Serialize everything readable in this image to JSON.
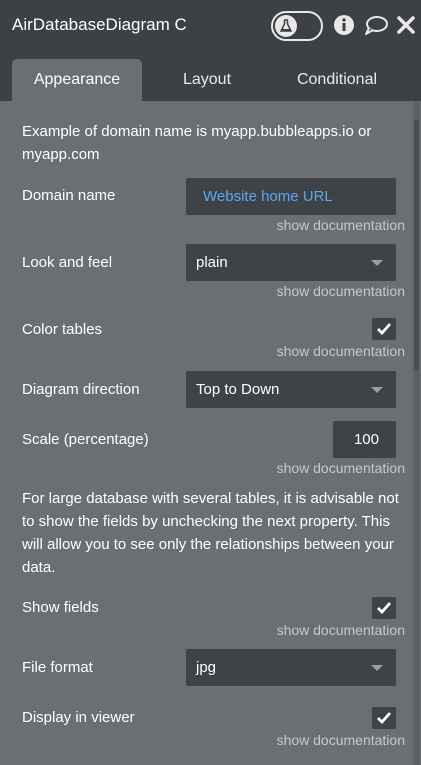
{
  "header": {
    "title": "AirDatabaseDiagram C",
    "icons": [
      "flask-icon",
      "info-icon",
      "comment-icon",
      "close-icon"
    ]
  },
  "tabs": [
    {
      "label": "Appearance",
      "active": true
    },
    {
      "label": "Layout",
      "active": false
    },
    {
      "label": "Conditional",
      "active": false
    }
  ],
  "form": {
    "intro_note": "Example of domain name is myapp.bubbleapps.io or myapp.com",
    "domain_name": {
      "label": "Domain name",
      "value": "Website home URL",
      "doc": "show documentation"
    },
    "look_and_feel": {
      "label": "Look and feel",
      "value": "plain",
      "doc": "show documentation"
    },
    "color_tables": {
      "label": "Color tables",
      "checked": true,
      "doc": "show documentation"
    },
    "diagram_direction": {
      "label": "Diagram direction",
      "value": "Top to Down"
    },
    "scale": {
      "label": "Scale (percentage)",
      "value": "100",
      "doc": "show documentation"
    },
    "fields_note": "For large database with several tables, it is advisable not to show the fields by unchecking the next property. This will allow you to see only the relationships between your data.",
    "show_fields": {
      "label": "Show fields",
      "checked": true,
      "doc": "show documentation"
    },
    "file_format": {
      "label": "File format",
      "value": "jpg"
    },
    "display_in_viewer": {
      "label": "Display in viewer",
      "checked": true,
      "doc": "show documentation"
    }
  },
  "colors": {
    "header_bg": "#3d4145",
    "panel_bg": "#6c6f72",
    "field_bg": "#3f4246",
    "link": "#5aa8f2",
    "doc_text": "#c6c8ca"
  }
}
